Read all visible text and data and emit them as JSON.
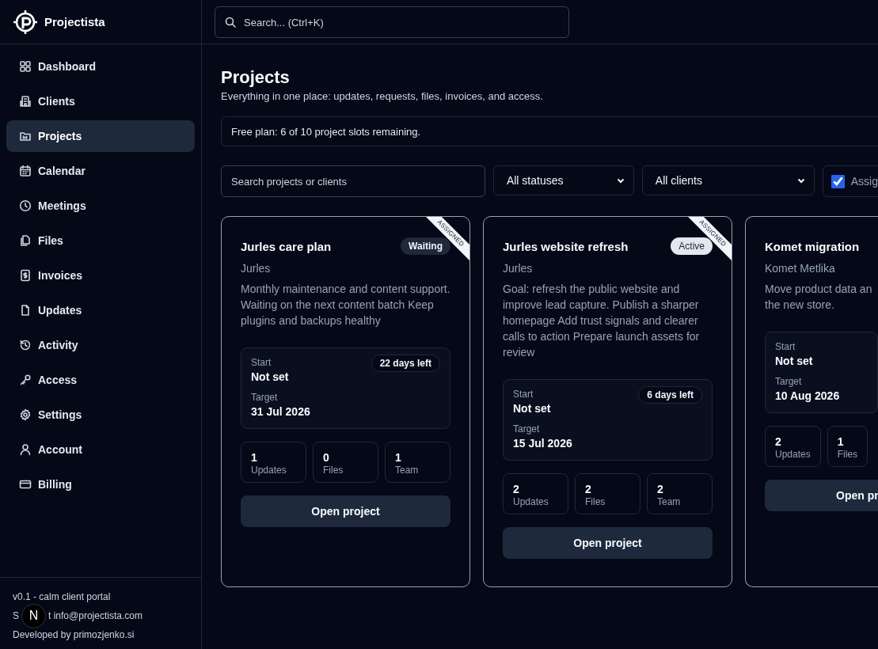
{
  "brand": {
    "name": "Projectista"
  },
  "sidebar": {
    "items": [
      {
        "label": "Dashboard",
        "selected": false
      },
      {
        "label": "Clients",
        "selected": false
      },
      {
        "label": "Projects",
        "selected": true
      },
      {
        "label": "Calendar",
        "selected": false
      },
      {
        "label": "Meetings",
        "selected": false
      },
      {
        "label": "Files",
        "selected": false
      },
      {
        "label": "Invoices",
        "selected": false
      },
      {
        "label": "Updates",
        "selected": false
      },
      {
        "label": "Activity",
        "selected": false
      },
      {
        "label": "Access",
        "selected": false
      },
      {
        "label": "Settings",
        "selected": false
      },
      {
        "label": "Account",
        "selected": false
      },
      {
        "label": "Billing",
        "selected": false
      }
    ],
    "footer": [
      [
        "v0.1 - calm client portal"
      ],
      [
        "S",
        "t info@projectista.com"
      ],
      [
        "Developed by primozjenko.si"
      ]
    ]
  },
  "dev_badge": "N",
  "search": {
    "placeholder": "Search... (Ctrl+K)"
  },
  "page": {
    "title": "Projects",
    "subtitle": "Everything in one place: updates, requests, files, invoices, and access."
  },
  "plan_notice": "Free plan: 6 of 10 project slots remaining.",
  "filters": {
    "search_placeholder": "Search projects or clients",
    "status": "All statuses",
    "client": "All clients",
    "assigned": {
      "label": "Assig",
      "checked": true
    }
  },
  "projects": [
    {
      "title": "Jurles care plan",
      "status": {
        "label": "Waiting",
        "kind": "waiting"
      },
      "ribbon": "ASSIGNED",
      "client": "Jurles",
      "description": "Monthly maintenance and content support. Waiting on the next content batch Keep plugins and backups healthy",
      "days_left": "22 days left",
      "start_label": "Start",
      "start": "Not set",
      "target_label": "Target",
      "target": "31 Jul 2026",
      "stats": [
        {
          "value": "1",
          "label": "Updates"
        },
        {
          "value": "0",
          "label": "Files"
        },
        {
          "value": "1",
          "label": "Team"
        }
      ],
      "button": "Open project"
    },
    {
      "title": "Jurles website refresh",
      "status": {
        "label": "Active",
        "kind": "active"
      },
      "ribbon": "ASSIGNED",
      "client": "Jurles",
      "description": "Goal: refresh the public website and improve lead capture. Publish a sharper homepage Add trust signals and clearer calls to action Prepare launch assets for review",
      "days_left": "6 days left",
      "start_label": "Start",
      "start": "Not set",
      "target_label": "Target",
      "target": "15 Jul 2026",
      "stats": [
        {
          "value": "2",
          "label": "Updates"
        },
        {
          "value": "2",
          "label": "Files"
        },
        {
          "value": "2",
          "label": "Team"
        }
      ],
      "button": "Open project"
    },
    {
      "title": "Komet migration",
      "client": "Komet Metlika",
      "description": "Move product data an the new store.",
      "start_label": "Start",
      "start": "Not set",
      "target_label": "Target",
      "target": "10 Aug 2026",
      "stats": [
        {
          "value": "2",
          "label": "Updates"
        },
        {
          "value": "1",
          "label": "Files"
        }
      ],
      "button": "Open pr"
    }
  ]
}
